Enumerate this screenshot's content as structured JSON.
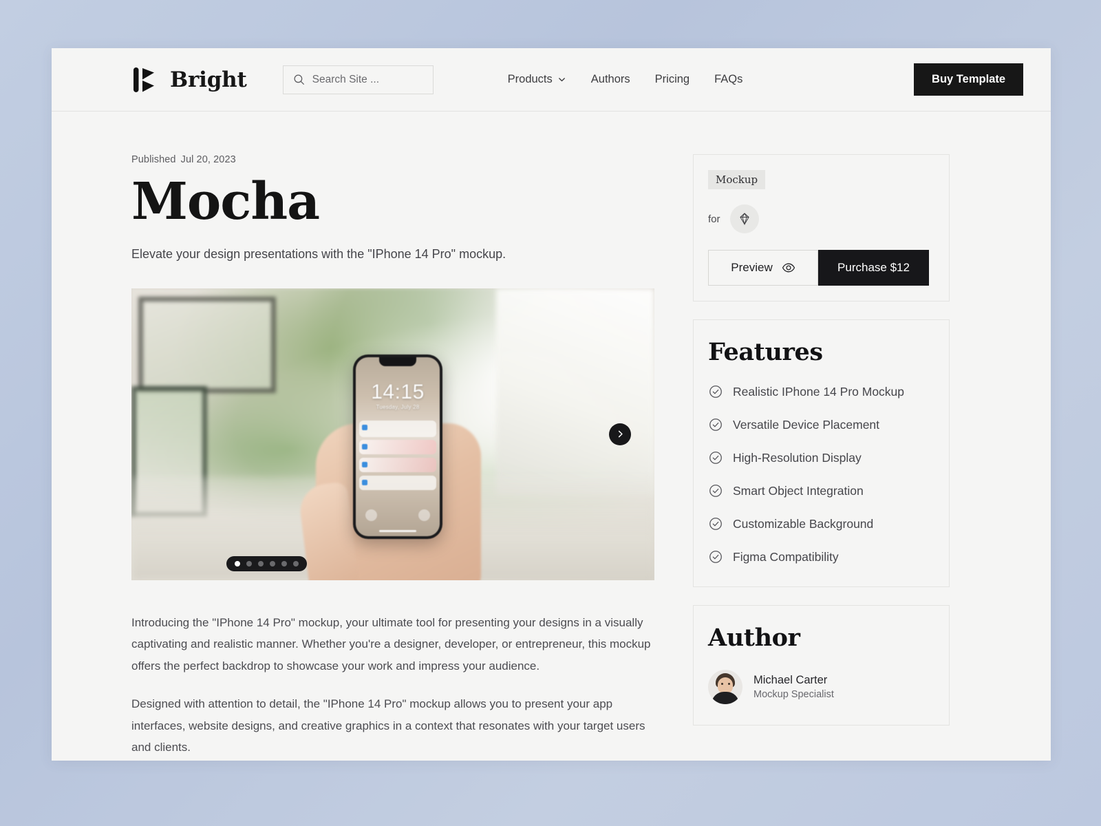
{
  "header": {
    "brand_name": "Bright",
    "brand_logo_icon": "bright-logo-icon",
    "search": {
      "placeholder": "Search Site ...",
      "value": "",
      "icon": "search-icon"
    },
    "nav": [
      {
        "label": "Products",
        "has_dropdown": true,
        "icon": "chevron-down-icon"
      },
      {
        "label": "Authors",
        "has_dropdown": false
      },
      {
        "label": "Pricing",
        "has_dropdown": false
      },
      {
        "label": "FAQs",
        "has_dropdown": false
      }
    ],
    "cta_label": "Buy Template"
  },
  "article": {
    "published_label": "Published",
    "published_date": "Jul 20, 2023",
    "title": "Mocha",
    "subtitle": "Elevate your design presentations with the \"IPhone 14 Pro\" mockup.",
    "carousel": {
      "next_icon": "chevron-right-icon",
      "total_slides": 6,
      "active_slide": 1,
      "phone_screen": {
        "time": "14:15",
        "date": "Tuesday, July 28"
      }
    },
    "paragraphs": [
      "Introducing the \"IPhone 14 Pro\" mockup, your ultimate tool for presenting your designs in a visually captivating and realistic manner. Whether you're a designer, developer, or entrepreneur, this mockup offers the perfect backdrop to showcase your work and impress your audience.",
      "Designed with attention to detail, the \"IPhone 14 Pro\" mockup allows you to present your app interfaces, website designs, and creative graphics in a context that resonates with your target users and clients."
    ]
  },
  "sidebar": {
    "purchase": {
      "category_tag": "Mockup",
      "for_label": "for",
      "tool_icon": "sketch-diamond-icon",
      "preview_label": "Preview",
      "preview_icon": "eye-icon",
      "purchase_label": "Purchase $12"
    },
    "features": {
      "heading": "Features",
      "check_icon": "check-circle-icon",
      "items": [
        "Realistic IPhone 14 Pro Mockup",
        "Versatile Device Placement",
        "High-Resolution Display",
        "Smart Object Integration",
        "Customizable Background",
        "Figma Compatibility"
      ]
    },
    "author": {
      "heading": "Author",
      "name": "Michael Carter",
      "role": "Mockup Specialist",
      "avatar_icon": "avatar"
    }
  },
  "colors": {
    "page_bg": "#f5f5f4",
    "desktop_bg": "#bcc8df",
    "accent_dark": "#17171a",
    "text_primary": "#141414",
    "text_muted": "#5c5c60",
    "border": "#e3e3e1"
  }
}
